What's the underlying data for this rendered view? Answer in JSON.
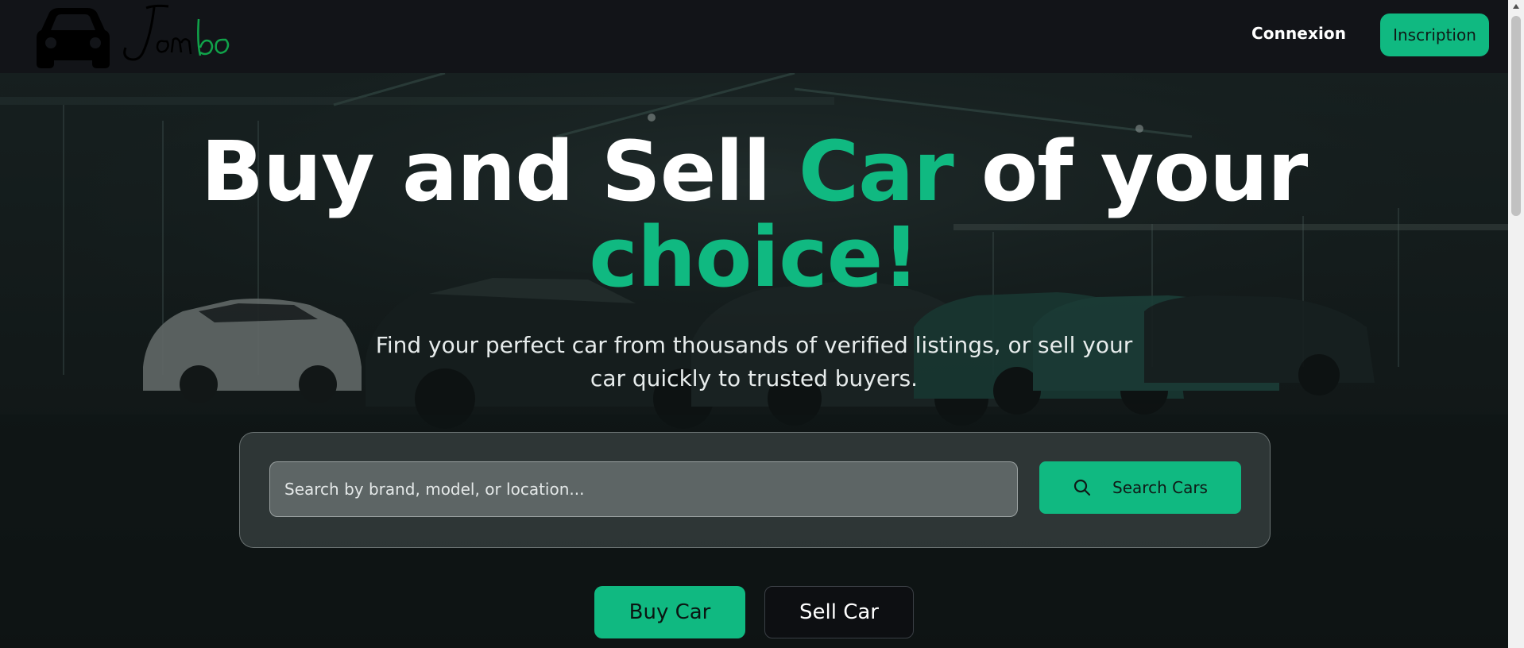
{
  "header": {
    "logo_alt": "Jombo",
    "login_label": "Connexion",
    "signup_label": "Inscription"
  },
  "hero": {
    "headline_part1": "Buy and Sell ",
    "headline_accent1": "Car",
    "headline_part2": " of your",
    "headline_accent2": "choice!",
    "subtitle": "Find your perfect car from thousands of verified listings, or sell your car quickly to trusted buyers."
  },
  "search": {
    "placeholder": "Search by brand, model, or location...",
    "button_label": "Search Cars"
  },
  "actions": {
    "buy_label": "Buy Car",
    "sell_label": "Sell Car"
  },
  "colors": {
    "accent": "#10b981",
    "header_bg": "#121418",
    "hero_bg": "#1a2424"
  },
  "icons": [
    "car-logo-icon",
    "search-icon",
    "scroll-up-arrow-icon"
  ]
}
